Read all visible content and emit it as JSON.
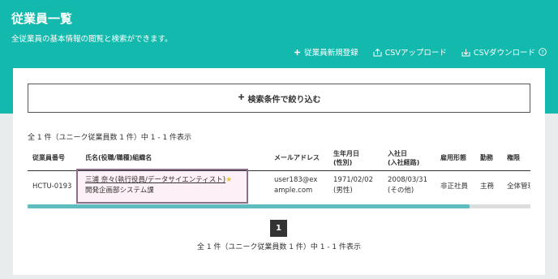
{
  "header": {
    "title": "従業員一覧",
    "subtitle": "全従業員の基本情報の閲覧と検索ができます。",
    "actions": [
      {
        "label": "従業員新規登録",
        "icon": "plus-icon"
      },
      {
        "label": "CSVアップロード",
        "icon": "upload-icon"
      },
      {
        "label": "CSVダウンロード",
        "icon": "download-icon"
      }
    ]
  },
  "search": {
    "label": "検索条件で絞り込む",
    "icon": "plus-icon"
  },
  "result_count": "全 1 件（ユニーク従業員数 1 件）中 1 - 1 件表示",
  "table": {
    "columns": [
      {
        "line1": "従業員番号",
        "line2": ""
      },
      {
        "line1": "氏名(役職/職種)組織名",
        "line2": ""
      },
      {
        "line1": "メールアドレス",
        "line2": ""
      },
      {
        "line1": "生年月日",
        "line2": "(性別)"
      },
      {
        "line1": "入社日",
        "line2": "(入社経路)"
      },
      {
        "line1": "雇用形態",
        "line2": ""
      },
      {
        "line1": "勤務",
        "line2": ""
      },
      {
        "line1": "権限",
        "line2": ""
      }
    ],
    "rows": [
      {
        "employee_id": "HCTU-0193",
        "name_role": "三浦 奈々(執行役員/データサイエンティスト)",
        "star": "★",
        "org": "開発企画部システム課",
        "email_line1": "user183@ex",
        "email_line2": "ample.com",
        "birth_date": "1971/02/02",
        "gender": "(男性)",
        "hire_date": "2008/03/31",
        "hire_route": "(その他)",
        "employment_type": "非正社員",
        "work": "主務",
        "permission": "全体管理"
      }
    ]
  },
  "pagination": {
    "current_page": "1"
  },
  "result_count_bottom": "全 1 件（ユニーク従業員数 1 件）中 1 - 1 件表示",
  "colors": {
    "accent": "#14b9ad",
    "scroll_thumb": "#5fbcbf",
    "star": "#e8c33a"
  }
}
